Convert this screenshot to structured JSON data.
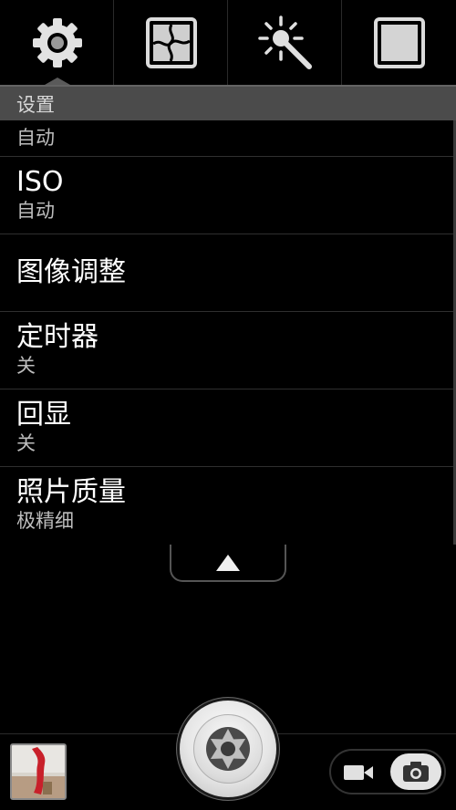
{
  "toolbar": {
    "buttons": [
      {
        "icon": "gear-icon",
        "active": true
      },
      {
        "icon": "image-effects-icon",
        "active": false
      },
      {
        "icon": "magic-wand-icon",
        "active": false
      },
      {
        "icon": "square-frame-icon",
        "active": false
      }
    ]
  },
  "settings": {
    "header": "设置",
    "items": [
      {
        "title": "",
        "value": "自动"
      },
      {
        "title": "ISO",
        "value": "自动"
      },
      {
        "title": "图像调整",
        "value": ""
      },
      {
        "title": "定时器",
        "value": "关"
      },
      {
        "title": "回显",
        "value": "关"
      },
      {
        "title": "照片质量",
        "value": "极精细"
      }
    ]
  },
  "bottom": {
    "collapse_icon": "up-arrow-icon",
    "shutter_icon": "aperture-icon",
    "modes": [
      "video-camera-icon",
      "camera-icon"
    ],
    "active_mode": "photo"
  },
  "colors": {
    "background": "#000000",
    "header_bg": "#4b4b4b",
    "text_primary": "#ffffff",
    "text_secondary": "#bdbdbd"
  }
}
